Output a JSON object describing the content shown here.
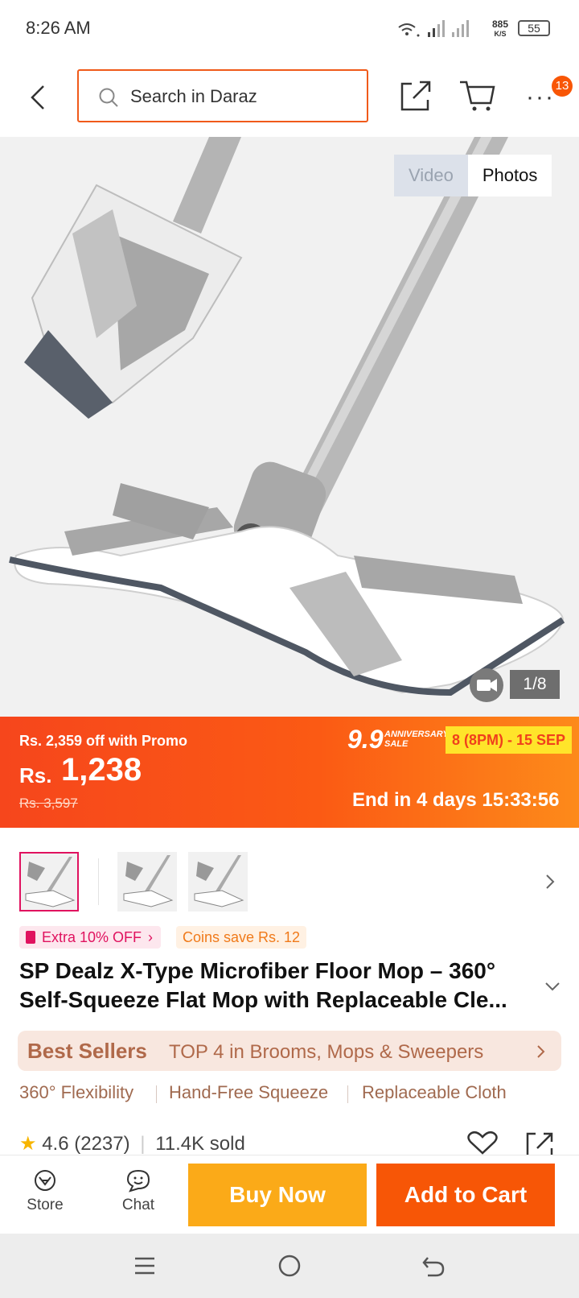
{
  "status_bar": {
    "time": "8:26 AM",
    "net_speed": "885",
    "net_unit": "K/S",
    "battery": "55"
  },
  "header": {
    "search_placeholder": "Search in Daraz",
    "cart_badge": "13"
  },
  "gallery": {
    "video_tab": "Video",
    "photos_tab": "Photos",
    "counter": "1/8"
  },
  "price_bar": {
    "promo_text": "Rs. 2,359 off with Promo",
    "currency": "Rs.",
    "price": "1,238",
    "original_price": "Rs. 3,597",
    "sale_number": "9.9",
    "sale_label_line1": "ANNIVERSARY",
    "sale_label_line2": "SALE",
    "sale_dates": "8 (8PM) - 15 SEP",
    "countdown": "End in 4 days 15:33:56"
  },
  "tags": {
    "extra_off": "Extra 10% OFF",
    "coins": "Coins save Rs. 12"
  },
  "product": {
    "title_line1": "SP Dealz X-Type Microfiber Floor Mop – 360°",
    "title_line2": "Self-Squeeze Flat Mop with Replaceable Cle..."
  },
  "best_sellers": {
    "label": "Best Sellers",
    "text": "TOP 4 in Brooms, Mops & Sweepers"
  },
  "features": [
    "360° Flexibility",
    "Hand-Free Squeeze",
    "Replaceable Cloth"
  ],
  "rating": {
    "score": "4.6",
    "count": "(2237)",
    "sold": "11.4K sold"
  },
  "bottom_bar": {
    "store": "Store",
    "chat": "Chat",
    "buy_now": "Buy Now",
    "add_to_cart": "Add to Cart"
  },
  "colors": {
    "brand_orange": "#f75606",
    "buy_now_yellow": "#fbaa18",
    "search_border": "#f05a1a"
  }
}
